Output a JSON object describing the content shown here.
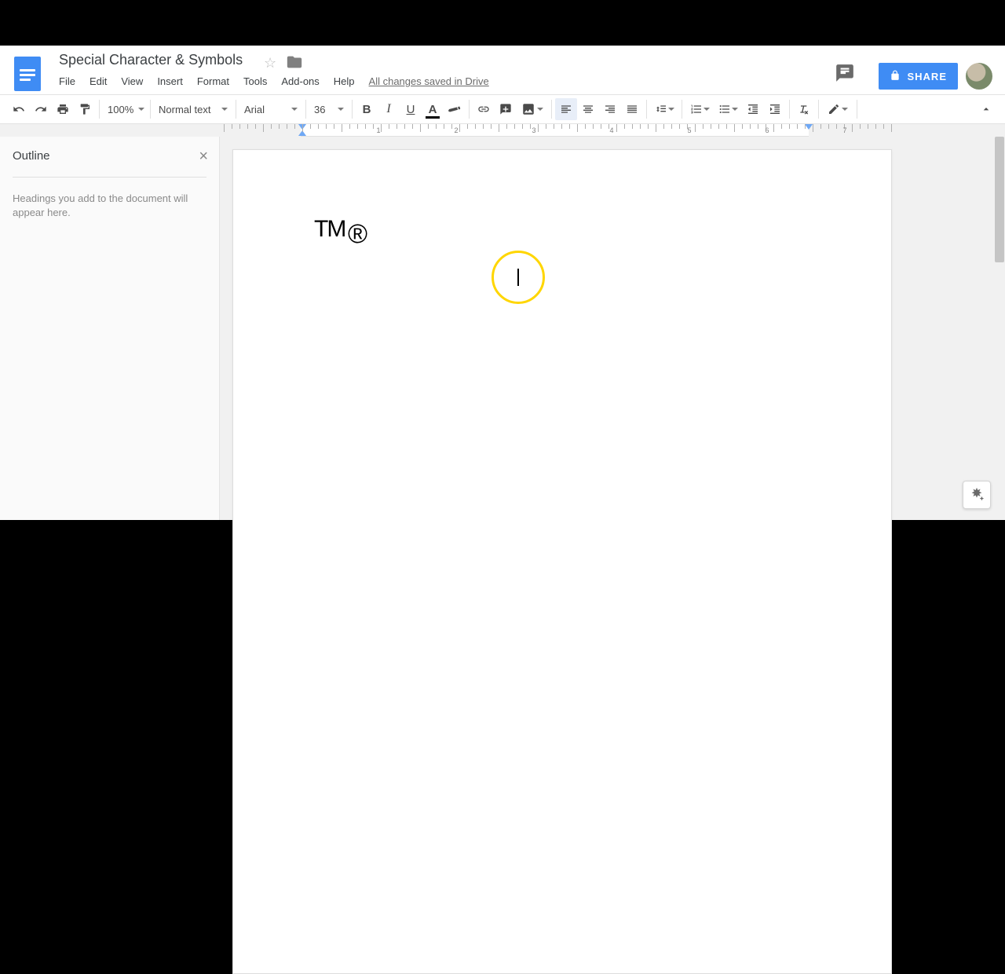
{
  "doc": {
    "title": "Special Character & Symbols",
    "save_status": "All changes saved in Drive"
  },
  "menubar": [
    "File",
    "Edit",
    "View",
    "Insert",
    "Format",
    "Tools",
    "Add-ons",
    "Help"
  ],
  "header": {
    "share_label": "SHARE"
  },
  "toolbar": {
    "zoom": "100%",
    "paragraph_style": "Normal text",
    "font": "Arial",
    "font_size": "36"
  },
  "ruler": {
    "numbers": [
      1,
      2,
      3,
      4,
      5,
      6,
      7
    ]
  },
  "outline": {
    "title": "Outline",
    "hint": "Headings you add to the document will appear here."
  },
  "page": {
    "text_tm": "TM",
    "text_r": "®"
  }
}
